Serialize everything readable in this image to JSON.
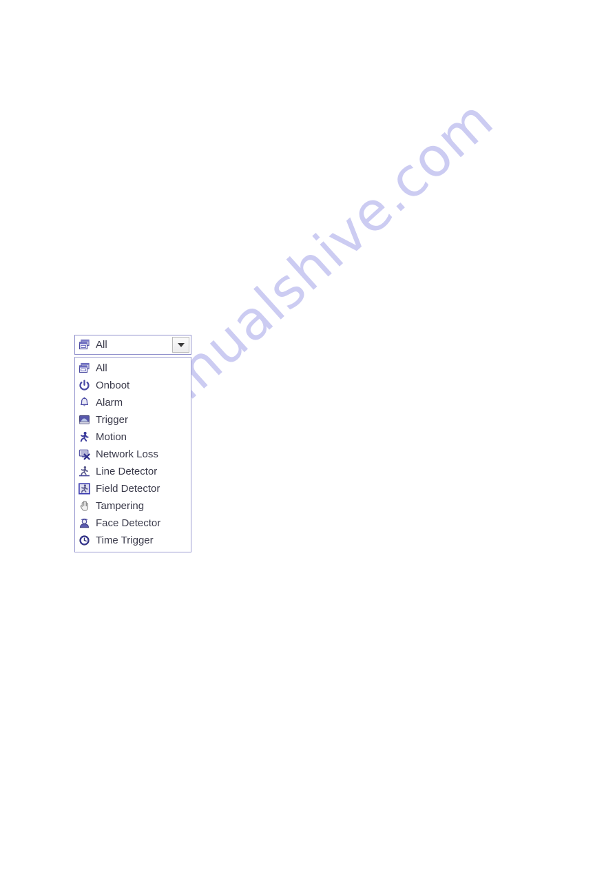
{
  "page": {
    "background_color": "#ffffff",
    "watermark_text": "manualshive.com",
    "watermark_color": "#ccccf2"
  },
  "combobox": {
    "name": "event-type-combobox",
    "selected_value": "All",
    "selected_icon": "all-events-icon",
    "expanded": true,
    "border_color": "#8e8ecb",
    "text_color": "#3a3a4a",
    "arrow_button": {
      "label": "",
      "icon": "chevron-down-icon",
      "border_color": "#b9b9b9"
    }
  },
  "listbox": {
    "border_color": "#9a9ad0",
    "background_color": "#ffffff",
    "items": [
      {
        "label": "All",
        "icon": "all-events-icon"
      },
      {
        "label": "Onboot",
        "icon": "power-icon"
      },
      {
        "label": "Alarm",
        "icon": "bell-icon"
      },
      {
        "label": "Trigger",
        "icon": "device-monitor-icon"
      },
      {
        "label": "Motion",
        "icon": "running-person-icon"
      },
      {
        "label": "Network Loss",
        "icon": "network-disconnected-icon"
      },
      {
        "label": "Line Detector",
        "icon": "line-crossing-person-icon"
      },
      {
        "label": "Field Detector",
        "icon": "field-intrusion-person-icon"
      },
      {
        "label": "Tampering",
        "icon": "hand-icon"
      },
      {
        "label": "Face Detector",
        "icon": "face-person-icon"
      },
      {
        "label": "Time Trigger",
        "icon": "clock-icon"
      }
    ]
  }
}
